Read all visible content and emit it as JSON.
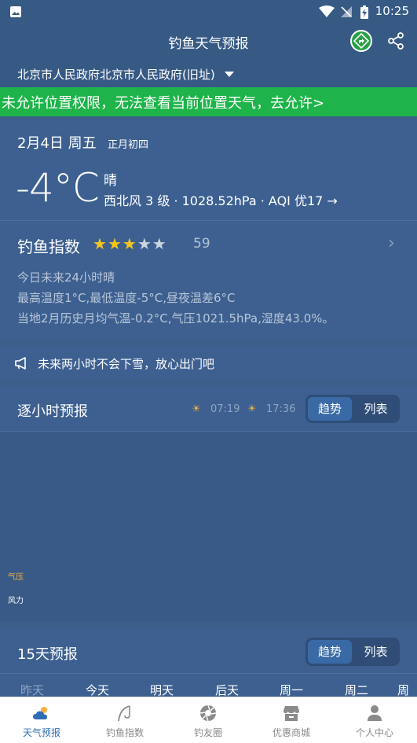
{
  "status_bar": {
    "time": "10:25"
  },
  "header": {
    "title": "钓鱼天气预报"
  },
  "location": {
    "name": "北京市人民政府北京市人民政府(旧址)"
  },
  "permission_banner": {
    "text": "未允许位置权限，无法查看当前位置天气，去允许>"
  },
  "today": {
    "date": "2月4日 周五",
    "lunar": "正月初四",
    "temperature": "-4°C",
    "condition": "晴",
    "detail": "西北风 3 级 · 1028.52hPa · AQI 优17 →"
  },
  "fishing": {
    "label": "钓鱼指数",
    "stars_total": 5,
    "stars_filled": 3,
    "score": "59",
    "lines": [
      "今日未来24小时晴",
      "最高温度1°C,最低温度-5°C,昼夜温差6°C",
      "当地2月历史月均气温-0.2°C,气压1021.5hPa,湿度43.0%。"
    ]
  },
  "notice": {
    "text": "未来两小时不会下雪，放心出门吧"
  },
  "hourly": {
    "title": "逐小时预报",
    "sunrise": "07:19",
    "sunset": "17:36",
    "toggle_trend": "趋势",
    "toggle_list": "列表",
    "legend_pressure": "气压",
    "legend_wind": "风力"
  },
  "daily": {
    "title": "15天预报",
    "toggle_trend": "趋势",
    "toggle_list": "列表",
    "days": [
      "昨天",
      "今天",
      "明天",
      "后天",
      "周一",
      "周二",
      "周"
    ]
  },
  "bottom_nav": {
    "items": [
      {
        "label": "天气预报",
        "icon": "weather-icon",
        "active": true
      },
      {
        "label": "钓鱼指数",
        "icon": "fishing-icon",
        "active": false
      },
      {
        "label": "钓友圈",
        "icon": "camera-aperture-icon",
        "active": false
      },
      {
        "label": "优惠商城",
        "icon": "shop-icon",
        "active": false
      },
      {
        "label": "个人中心",
        "icon": "person-icon",
        "active": false
      }
    ]
  },
  "colors": {
    "background": "#3c5e8a",
    "banner_green": "#1eb44a",
    "star_gold": "#f7c518",
    "nav_active": "#2f6eb6"
  }
}
